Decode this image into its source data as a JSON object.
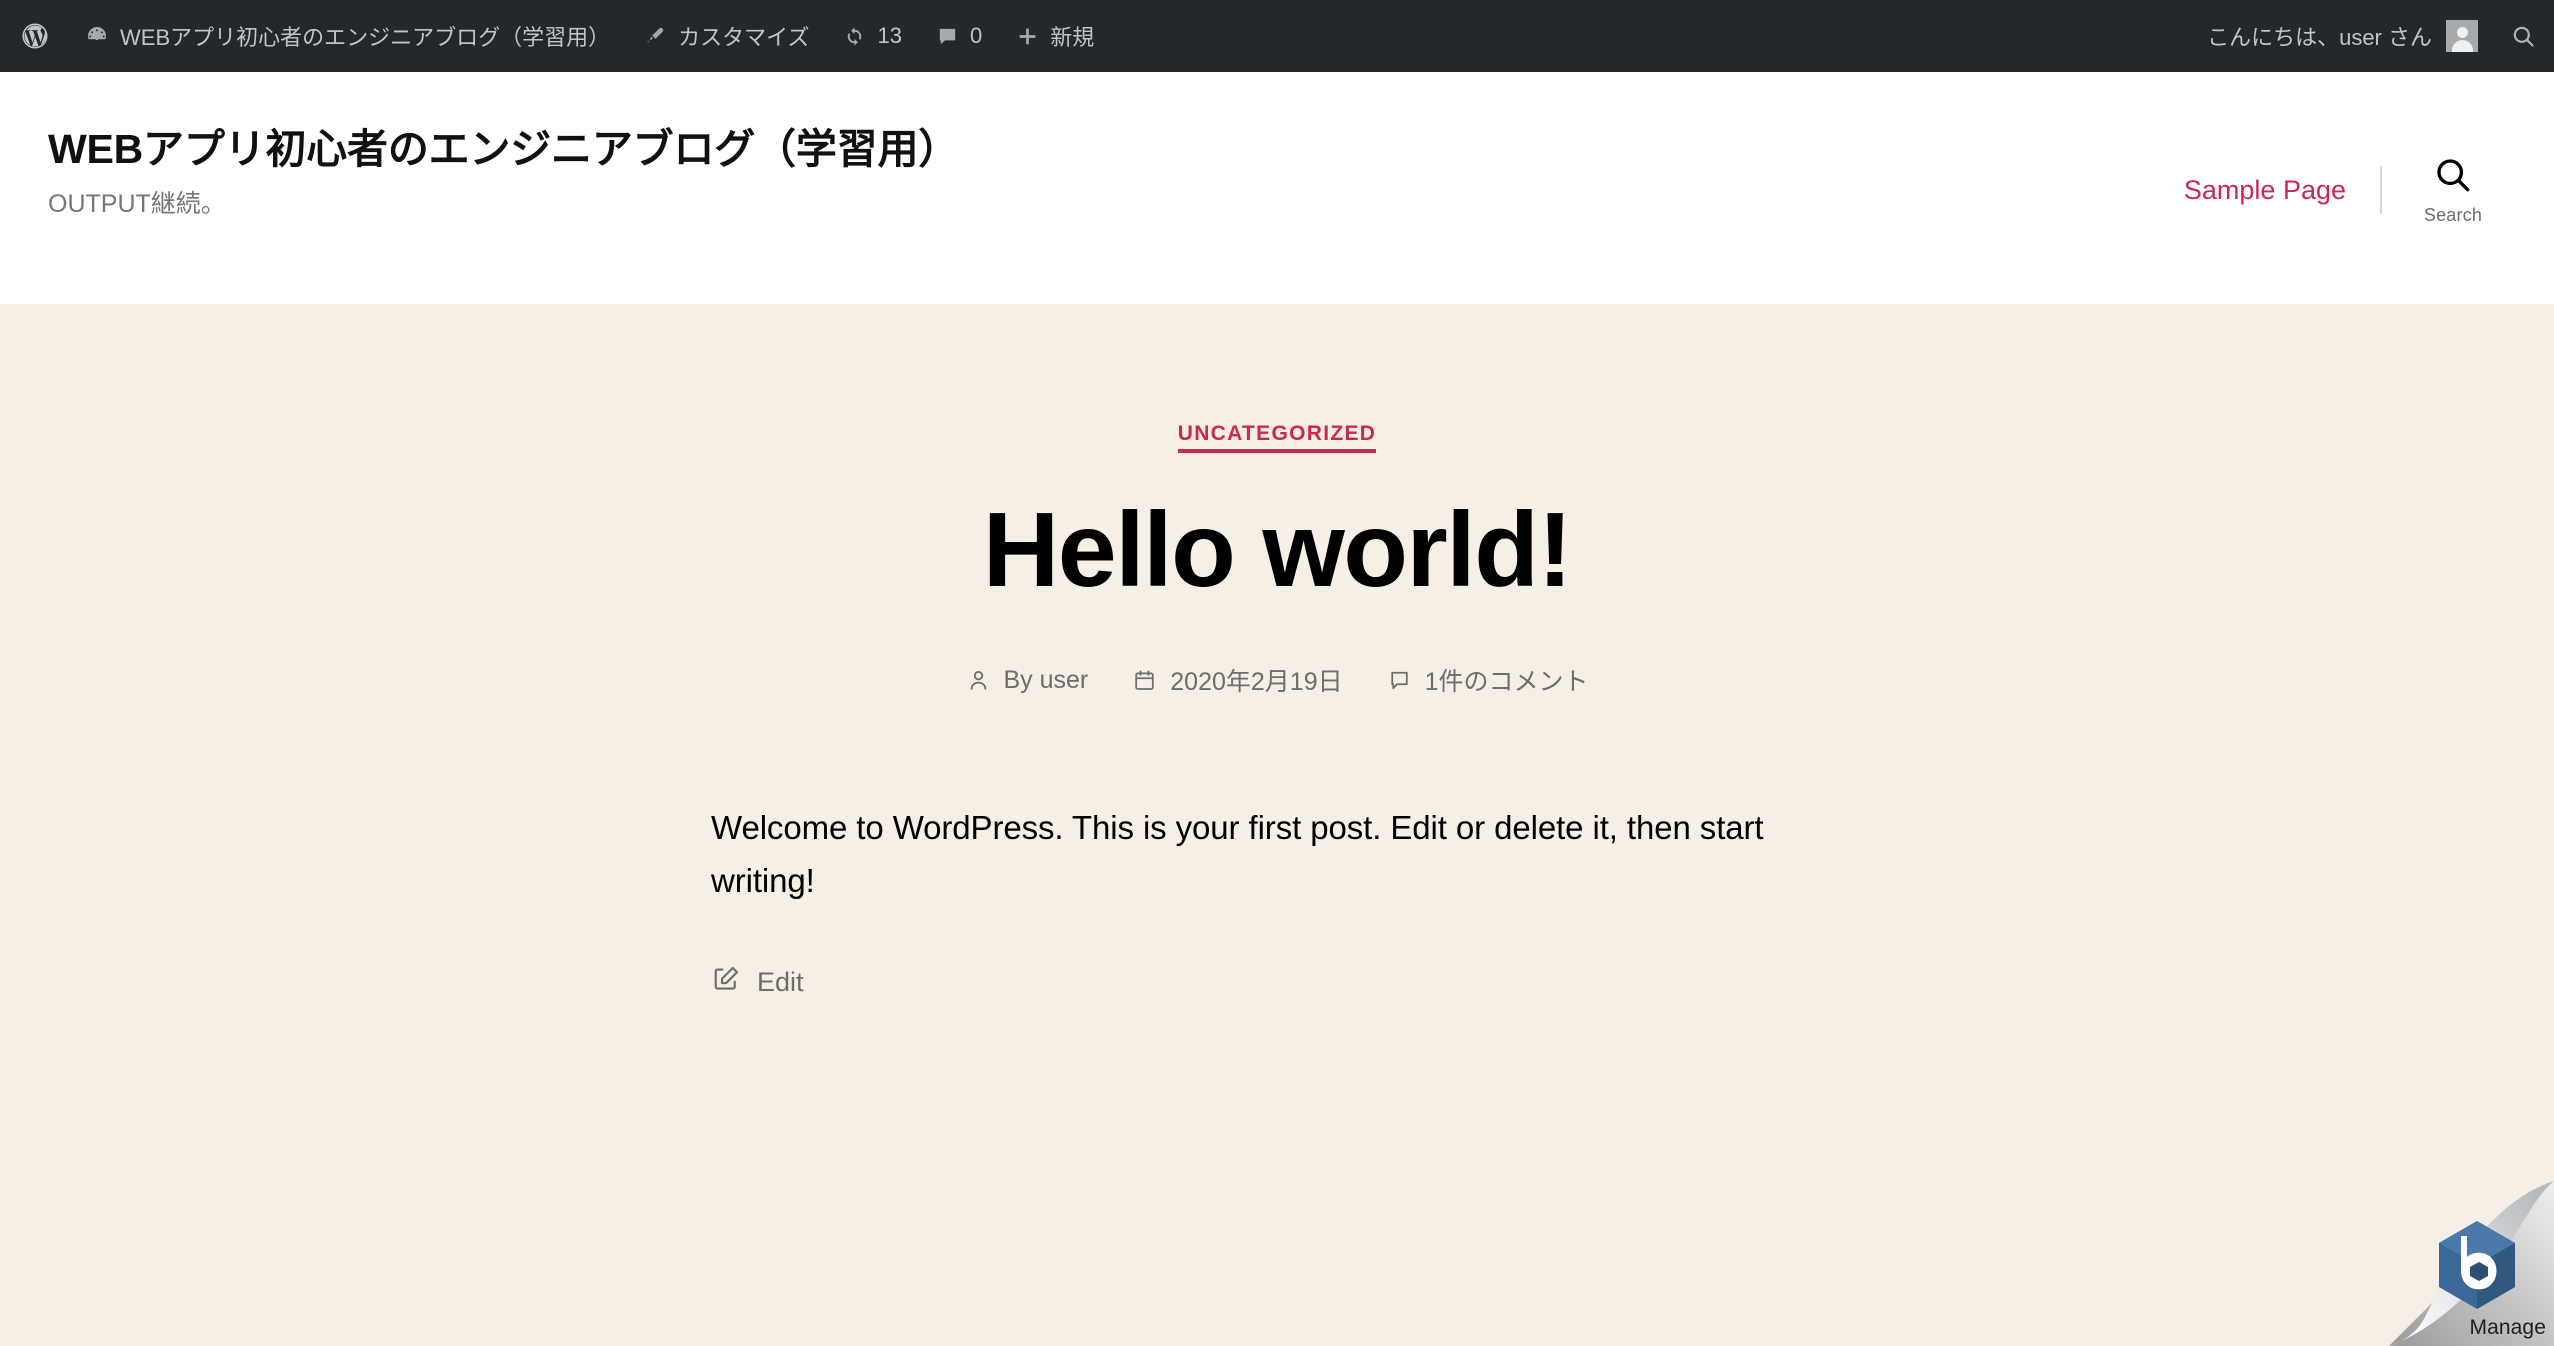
{
  "adminbar": {
    "wp_logo": "wordpress-logo-icon",
    "site_name": "WEBアプリ初心者のエンジニアブログ（学習用）",
    "customize": "カスタマイズ",
    "updates_count": "13",
    "comments_count": "0",
    "new": "新規",
    "greeting": "こんにちは、user さん",
    "search": "search-icon",
    "bg_color": "#23282d",
    "text_color": "#c3c4c7"
  },
  "header": {
    "site_title": "WEBアプリ初心者のエンジニアブログ（学習用）",
    "site_description": "OUTPUT継続。",
    "nav": [
      {
        "label": "Sample Page"
      }
    ],
    "search_label": "Search",
    "accent_color": "#cd2653",
    "bg_color": "#ffffff"
  },
  "post": {
    "category": "UNCATEGORIZED",
    "title": "Hello world!",
    "meta": {
      "author": "By user",
      "date": "2020年2月19日",
      "comments": "1件のコメント"
    },
    "body": "Welcome to WordPress. This is your first post. Edit or delete it, then start writing!",
    "edit_label": "Edit"
  },
  "badge": {
    "label": "Manage",
    "logo_color": "#3b6896"
  },
  "theme": {
    "content_bg": "#f5efe5",
    "body_text": "#000000",
    "muted_text": "#6d6d6d"
  }
}
